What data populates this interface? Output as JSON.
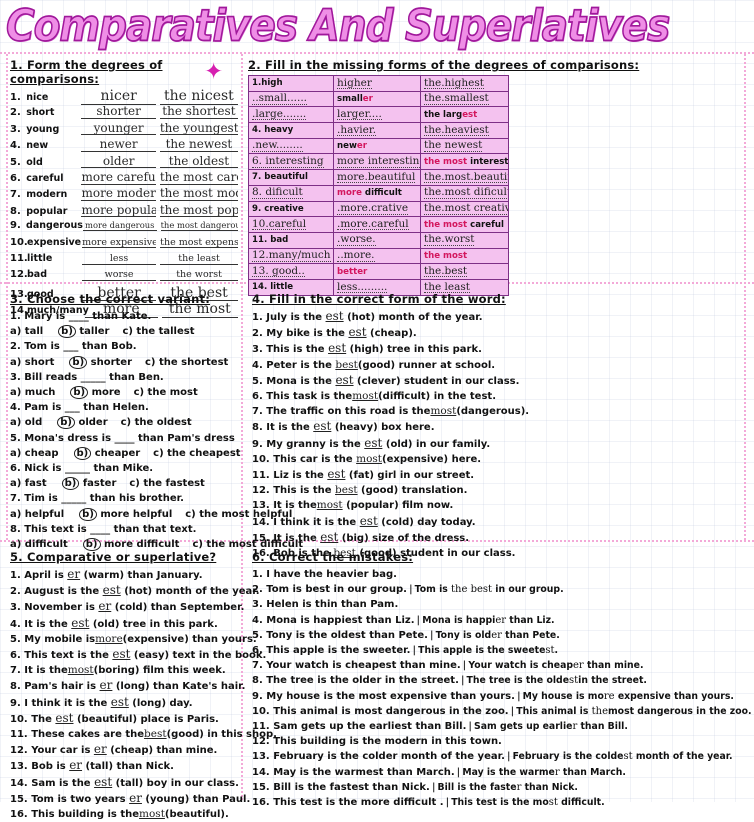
{
  "title": "Comparatives And Superlatives",
  "decor": {
    "star": "✦"
  },
  "colors": {
    "title_fill": "#ef8ee6",
    "title_outline": "#a0189b",
    "table_cell": "#f4c2ef",
    "table_border": "#7d2f86",
    "accent_red": "#d3165e",
    "frame_dots": "#f3a9d8"
  },
  "ex1": {
    "heading": "1. Form the degrees of comparisons:",
    "rows": [
      {
        "n": "1.",
        "word": "nice",
        "comp": "nicer",
        "sup": "the nicest",
        "size": "s-lg"
      },
      {
        "n": "2.",
        "word": "short",
        "comp": "shorter",
        "sup": "the shortest",
        "size": "s-md"
      },
      {
        "n": "3.",
        "word": "young",
        "comp": "younger",
        "sup": "the youngest",
        "size": "s-md"
      },
      {
        "n": "4.",
        "word": "new",
        "comp": "newer",
        "sup": "the newest",
        "size": "s-md"
      },
      {
        "n": "5.",
        "word": "old",
        "comp": "older",
        "sup": "the oldest",
        "size": "s-md"
      },
      {
        "n": "6.",
        "word": "careful",
        "comp": "more careful",
        "sup": "the most careful",
        "size": "s-md"
      },
      {
        "n": "7.",
        "word": "modern",
        "comp": "more modern",
        "sup": "the most modern",
        "size": "s-md"
      },
      {
        "n": "8.",
        "word": "popular",
        "comp": "more popular",
        "sup": "the most popular",
        "size": "s-md"
      },
      {
        "n": "9.",
        "word": "dangerous",
        "comp": "more dangerous",
        "sup": "the most dangerous",
        "size": "s-xs"
      },
      {
        "n": "10.",
        "word": "expensive",
        "comp": "more expensive",
        "sup": "the most expensive",
        "size": "s-sm"
      },
      {
        "n": "11.",
        "word": "little",
        "comp": "less",
        "sup": "the least",
        "size": "s-sm"
      },
      {
        "n": "12.",
        "word": "bad",
        "comp": "worse",
        "sup": "the worst",
        "size": "s-sm"
      },
      {
        "n": "13.",
        "word": "good",
        "comp": "better",
        "sup": "the best",
        "size": "s-lg"
      },
      {
        "n": "14.",
        "word": "much/many",
        "comp": "more",
        "sup": "the most",
        "size": "s-lg"
      }
    ]
  },
  "ex2": {
    "heading": "2. Fill in the missing forms of the degrees of comparisons:",
    "rows": [
      {
        "c1": "1.high",
        "c1hw": false,
        "c2": "higher",
        "c2hw": true,
        "c2root": "",
        "c2sfx": "",
        "c3": "the.highest",
        "c3hw": true,
        "c3root": "",
        "c3sfx": ""
      },
      {
        "c1": "..small......",
        "c1hw": true,
        "c2": "",
        "c2hw": false,
        "c2root": "small",
        "c2sfx": "er",
        "c3": "the.smallest",
        "c3hw": true,
        "c3root": "",
        "c3sfx": ""
      },
      {
        "c1": ".large.......",
        "c1hw": true,
        "c2": "larger....",
        "c2hw": true,
        "c2root": "",
        "c2sfx": "",
        "c3": "",
        "c3hw": false,
        "c3root": "the larg",
        "c3sfx": "est",
        "c3red": true
      },
      {
        "c1": "4. heavy",
        "c1hw": false,
        "c2": ".havier.",
        "c2hw": true,
        "c2root": "",
        "c2sfx": "",
        "c3": "the.heaviest",
        "c3hw": true,
        "c3root": "",
        "c3sfx": ""
      },
      {
        "c1": ".new........",
        "c1hw": true,
        "c2": "",
        "c2hw": false,
        "c2root": "new",
        "c2sfx": "er",
        "c3": "the newest",
        "c3hw": true,
        "c3root": "",
        "c3sfx": ""
      },
      {
        "c1": "6. interesting",
        "c1hw": true,
        "c2": "more interesting",
        "c2hw": true,
        "c2root": "",
        "c2sfx": "",
        "c3": "",
        "c3hw": false,
        "c3root": "interesting",
        "c3sfx": "",
        "c3pre": "the most "
      },
      {
        "c1": "7. beautiful",
        "c1hw": false,
        "c2": "more.beautiful",
        "c2hw": true,
        "c2root": "",
        "c2sfx": "",
        "c3": "the.most.beautiful",
        "c3hw": true,
        "c3root": "",
        "c3sfx": ""
      },
      {
        "c1": "8. dificult",
        "c1hw": true,
        "c2": "",
        "c2hw": false,
        "c2root": "difficult",
        "c2sfx": "",
        "c2pre": "more ",
        "c3": "the.most dificult",
        "c3hw": true,
        "c3root": "",
        "c3sfx": ""
      },
      {
        "c1": "9. creative",
        "c1hw": false,
        "c2": ".more.crative",
        "c2hw": true,
        "c2root": "",
        "c2sfx": "",
        "c3": "the.most creative",
        "c3hw": true,
        "c3root": "",
        "c3sfx": ""
      },
      {
        "c1": "10.careful",
        "c1hw": true,
        "c2": ".more.careful",
        "c2hw": true,
        "c2root": "",
        "c2sfx": "",
        "c3": "",
        "c3hw": false,
        "c3root": "careful",
        "c3sfx": "",
        "c3pre": "the most "
      },
      {
        "c1": "11.  bad",
        "c1hw": false,
        "c2": ".worse.",
        "c2hw": true,
        "c2root": "",
        "c2sfx": "",
        "c3": "the.worst",
        "c3hw": true,
        "c3root": "",
        "c3sfx": ""
      },
      {
        "c1": "12.many/much",
        "c1hw": true,
        "c2": "..more.",
        "c2hw": true,
        "c2root": "",
        "c2sfx": "",
        "c3": "",
        "c3hw": false,
        "c3root": "",
        "c3sfx": "",
        "c3pre": "the most",
        "c3red": true
      },
      {
        "c1": "13. good..",
        "c1hw": true,
        "c2": "",
        "c2hw": false,
        "c2root": "",
        "c2sfx": "",
        "c2pre": "better",
        "c2red": true,
        "c3": "the.best",
        "c3hw": true,
        "c3root": "",
        "c3sfx": ""
      },
      {
        "c1": "14. little",
        "c1hw": false,
        "c2": "less.........",
        "c2hw": true,
        "c2root": "",
        "c2sfx": "",
        "c3": "the least",
        "c3hw": true,
        "c3root": "",
        "c3sfx": ""
      }
    ]
  },
  "ex3": {
    "heading": "3. Choose the correct variant:",
    "items": [
      {
        "q": "1. Mary is ____ than Kate.",
        "a": "a) tall",
        "b": "taller",
        "c": "c) the tallest"
      },
      {
        "q": "2. Tom is ___ than Bob.",
        "a": "a) short",
        "b": "shorter",
        "c": "c) the shortest"
      },
      {
        "q": "3. Bill reads _____ than Ben.",
        "a": "a) much",
        "b": "more",
        "c": "c) the most"
      },
      {
        "q": "4. Pam is ___ than Helen.",
        "a": "a) old",
        "b": "older",
        "c": "c)  the oldest"
      },
      {
        "q": "5. Mona's dress is ____ than Pam's dress",
        "a": "a) cheap",
        "b": "cheaper",
        "c": "c) the cheapest"
      },
      {
        "q": "6. Nick is _____ than Mike.",
        "a": "a) fast",
        "b": "faster",
        "c": "c) the fastest"
      },
      {
        "q": "7. Tim is _____ than his brother.",
        "a": "a) helpful",
        "b": "more helpful",
        "c": "c) the most helpful"
      },
      {
        "q": "8. This text is ____ than that text.",
        "a": "a) difficult",
        "b": "more difficult",
        "c": "c) the most difficult"
      }
    ],
    "choice_label": "b)"
  },
  "ex4": {
    "heading": "4. Fill in the correct form of the word:",
    "items": [
      {
        "pre": "1. July is the ",
        "ans": "est",
        "post": " (hot) month of the year."
      },
      {
        "pre": "2. My bike is the ",
        "ans": "est",
        "post": " (cheap)."
      },
      {
        "pre": "3. This is the ",
        "ans": "est",
        "post": " (high) tree in this park."
      },
      {
        "pre": "4. Peter is the ",
        "ans": "best",
        "post": "(good) runner at school."
      },
      {
        "pre": "5. Mona is the ",
        "ans": "est",
        "post": " (clever) student in our class."
      },
      {
        "pre": "6. This task is the",
        "ans": "most",
        "post": "(difficult) in the test."
      },
      {
        "pre": "7. The traffic on this road is the",
        "ans": "most",
        "post": "(dangerous)."
      },
      {
        "pre": "8. It is the ",
        "ans": "est",
        "post": " (heavy) box here."
      },
      {
        "pre": "9. My granny is the ",
        "ans": "est",
        "post": " (old) in our family."
      },
      {
        "pre": "10. This car is the ",
        "ans": "most",
        "post": "(expensive) here."
      },
      {
        "pre": "11. Liz is the ",
        "ans": "est",
        "post": " (fat) girl in our street."
      },
      {
        "pre": "12. This is the ",
        "ans": "best",
        "post": " (good) translation."
      },
      {
        "pre": "13. It is the",
        "ans": "most",
        "post": " (popular) film now."
      },
      {
        "pre": "14. I think it is the ",
        "ans": "est",
        "post": " (cold) day today."
      },
      {
        "pre": "15. It is the ",
        "ans": "est",
        "post": " (big) size of the dress."
      },
      {
        "pre": "16. Bob is the ",
        "ans": "best",
        "post": " (good) student in our class."
      }
    ]
  },
  "ex5": {
    "heading": "5. Comparative or superlative?",
    "items": [
      {
        "pre": "1. April is ",
        "ans": "er",
        "post": " (warm) than January."
      },
      {
        "pre": "2. August is the ",
        "ans": "est",
        "post": " (hot) month of the year."
      },
      {
        "pre": "3. November is ",
        "ans": "er",
        "post": " (cold) than September."
      },
      {
        "pre": "4. It is the ",
        "ans": "est",
        "post": " (old) tree in this park."
      },
      {
        "pre": "5. My mobile is",
        "ans": "more",
        "post": "(expensive) than yours."
      },
      {
        "pre": "6. This text is the ",
        "ans": "est",
        "post": " (easy) text in the book."
      },
      {
        "pre": "7. It is the",
        "ans": "most",
        "post": "(boring) film this week."
      },
      {
        "pre": "8. Pam's hair is ",
        "ans": "er",
        "post": " (long) than Kate's hair."
      },
      {
        "pre": "9. I think it is the ",
        "ans": "est",
        "post": " (long) day."
      },
      {
        "pre": "10. The ",
        "ans": "est",
        "post": " (beautiful) place is Paris."
      },
      {
        "pre": "11. These cakes are the",
        "ans": "best",
        "post": "(good) in this shop."
      },
      {
        "pre": "12. Your car is ",
        "ans": "er",
        "post": " (cheap) than mine."
      },
      {
        "pre": "13. Bob is ",
        "ans": "er",
        "post": " (tall) than Nick."
      },
      {
        "pre": "14. Sam is the ",
        "ans": "est",
        "post": " (tall) boy in our class."
      },
      {
        "pre": "15. Tom is two years ",
        "ans": "er",
        "post": " (young) than Paul."
      },
      {
        "pre": "16. This building is the",
        "ans": "most",
        "post": "(beautiful)."
      }
    ]
  },
  "ex6": {
    "heading": "6. Correct the mistakes:",
    "items": [
      {
        "q": "1. I have the heavier bag.",
        "fix_pre": "",
        "fix_sfx": "",
        "fix_post": ""
      },
      {
        "q": "2. Tom is best in our group.",
        "fix_pre": "Tom is ",
        "fix_sfx": "the best",
        "fix_post": " in our group."
      },
      {
        "q": "3. Helen is thin than Pam.",
        "fix_pre": "",
        "fix_sfx": "",
        "fix_post": ""
      },
      {
        "q": "4. Mona is happiest than Liz.",
        "fix_pre": "Mona is happi",
        "fix_sfx": "er",
        "fix_post": "  than Liz."
      },
      {
        "q": "5. Tony is the oldest than Pete.",
        "fix_pre": "Tony is old",
        "fix_sfx": "er",
        "fix_post": "  than Pete."
      },
      {
        "q": "6. This apple is the sweeter.",
        "fix_pre": "This apple is the sweete",
        "fix_sfx": "st",
        "fix_post": "."
      },
      {
        "q": "7. Your watch is cheapest than mine.",
        "fix_pre": "Your watch is cheap",
        "fix_sfx": "er",
        "fix_post": "  than mine."
      },
      {
        "q": "8. The tree is the older in the street.",
        "fix_pre": "The tree is the olde",
        "fix_sfx": "st",
        "fix_post": "in the street."
      },
      {
        "q": "9. My house is the most expensive than yours.",
        "fix_pre": "My house is mo",
        "fix_sfx": "re",
        "fix_post": " expensive than yours."
      },
      {
        "q": "10. This animal is most dangerous in the zoo.",
        "fix_pre": "This animal is ",
        "fix_sfx": "the",
        "fix_post": "most dangerous in the zoo."
      },
      {
        "q": "11. Sam gets up the earliest than Bill.",
        "fix_pre": "Sam gets up earlie",
        "fix_sfx": "r",
        "fix_post": "  than Bill."
      },
      {
        "q": "12. This building is the modern in this town.",
        "fix_pre": "",
        "fix_sfx": "",
        "fix_post": ""
      },
      {
        "q": "13. February is the colder month of the year.",
        "fix_pre": "February is the colde",
        "fix_sfx": "st",
        "fix_post": " month of the year."
      },
      {
        "q": "14. May is the warmest than March.",
        "fix_pre": "May is the warme",
        "fix_sfx": "r",
        "fix_post": "  than March."
      },
      {
        "q": "15. Bill is the fastest than Nick.",
        "fix_pre": "Bill is the faste",
        "fix_sfx": "r",
        "fix_post": "  than Nick."
      },
      {
        "q": "16. This test is the more difficult .",
        "fix_pre": "This test is the mo",
        "fix_sfx": "st",
        "fix_post": "  difficult."
      }
    ]
  }
}
